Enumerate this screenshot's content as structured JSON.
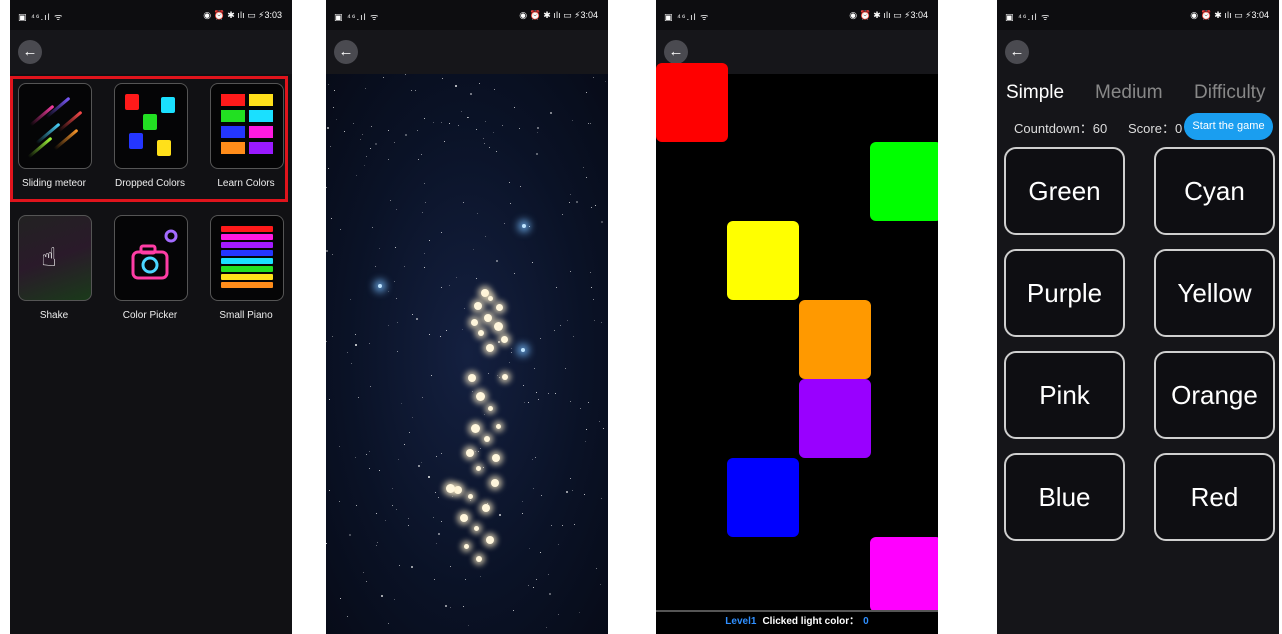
{
  "panel1": {
    "status_left": "▣ ⁴⁶.ıl ᯤ",
    "status_right": "◉ ⏰ ✱ ıǀı ▭ ⚡3:03",
    "apps": [
      {
        "label": "Sliding meteor",
        "icon": "meteor-icon"
      },
      {
        "label": "Dropped Colors",
        "icon": "dropped-colors-icon"
      },
      {
        "label": "Learn Colors",
        "icon": "learn-colors-icon"
      },
      {
        "label": "Shake",
        "icon": "shake-hand-icon"
      },
      {
        "label": "Color Picker",
        "icon": "camera-icon"
      },
      {
        "label": "Small Piano",
        "icon": "piano-icon"
      }
    ],
    "highlight_color": "#e0141c"
  },
  "panel2": {
    "status_left": "▣ ⁴⁶.ıl ᯤ",
    "status_right": "◉ ⏰ ✱ ıǀı ▭ ⚡3:04"
  },
  "panel3": {
    "status_left": "▣ ⁴⁶.ıl ᯤ",
    "status_right": "◉ ⏰ ✱ ıǀı ▭ ⚡3:04",
    "level": "Level1",
    "clicked_label": "Clicked light color：",
    "clicked_count": "0",
    "colors": [
      "#ff0000",
      "#00ff00",
      "#ffff00",
      "#ff9900",
      "#9900ff",
      "#0000ff",
      "#ff00ff"
    ]
  },
  "panel4": {
    "status_left": "▣ ⁴⁶.ıl ᯤ",
    "status_right": "◉ ⏰ ✱ ıǀı ▭ ⚡3:04",
    "difficulty_tabs": [
      "Simple",
      "Medium",
      "Difficulty"
    ],
    "countdown_label": "Countdown：60",
    "score_label": "Score：0",
    "start_button": "Start the game",
    "color_buttons": [
      "Green",
      "Cyan",
      "Purple",
      "Yellow",
      "Pink",
      "Orange",
      "Blue",
      "Red"
    ]
  }
}
